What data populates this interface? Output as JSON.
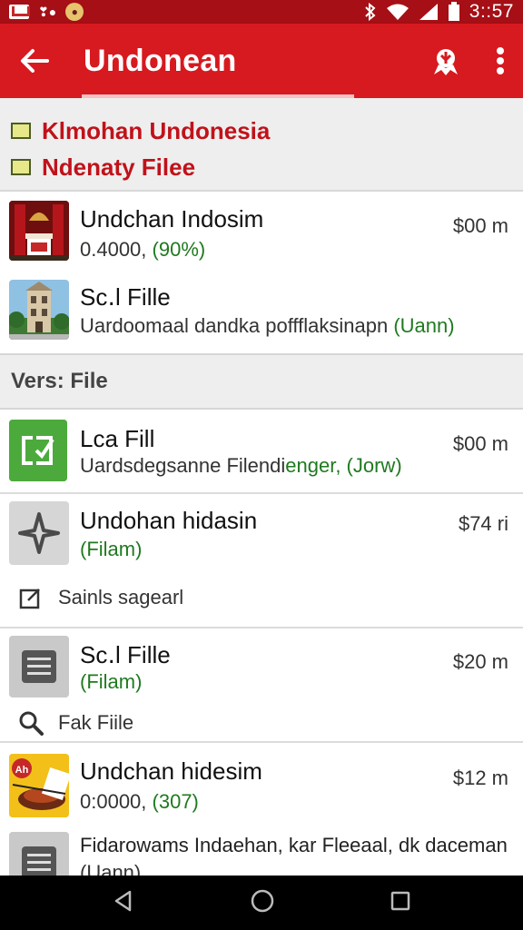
{
  "status_bar": {
    "time": "3::57",
    "left_icons": [
      "gmail-icon",
      "notification-glyph-icon",
      "app-badge-icon"
    ],
    "right_icons": [
      "bluetooth-icon",
      "wifi-icon",
      "signal-icon",
      "battery-icon"
    ]
  },
  "app_bar": {
    "title": "Undonean",
    "background": "#d71920"
  },
  "legend": [
    {
      "label": "Klmohan Undonesia"
    },
    {
      "label": "Ndenaty Filee"
    }
  ],
  "list_top": [
    {
      "title": "Undchan Indosim",
      "sub_plain": "0.4000, ",
      "sub_green": "(90%)",
      "price": "$00 m",
      "thumb": "shrine-icon"
    },
    {
      "title": "Sc․l Fille",
      "sub_plain": "Uardoomaal dandka poffflaksinapn ",
      "sub_green": "(Uann)",
      "price": "",
      "thumb": "building-icon"
    }
  ],
  "section": {
    "title": "Vers: File"
  },
  "list_files": [
    {
      "title": "Lca Fill",
      "sub_plain": "Uardsdegsanne Filendi",
      "sub_green": "enger, (Jorw)",
      "price": "$00 m",
      "thumb": "check-doc-icon"
    },
    {
      "title": "Undohan hidasin",
      "sub_plain": "",
      "sub_green": "(Filam)",
      "price": "$74 ri",
      "thumb": "compass-icon",
      "action": "Sainls sagearl",
      "action_icon": "edit-icon"
    },
    {
      "title": "Sc․l Fille",
      "sub_plain": "",
      "sub_green": "(Filam)",
      "price": "$20 m",
      "thumb": "document-icon",
      "action": "Fak Fiile",
      "action_icon": "search-icon"
    },
    {
      "title": "Undchan hidesim",
      "sub_plain": "0:0000, ",
      "sub_green": "(307)",
      "price": "$12 m",
      "thumb": "food-icon"
    },
    {
      "title": "Fidarowams Indaehan, kar Fleeaal, dk daceman",
      "sub_plain": "(Uann)",
      "sub_green": "",
      "price": "",
      "thumb": "document-icon"
    }
  ],
  "nav": [
    "back-icon",
    "home-icon",
    "recents-icon"
  ]
}
